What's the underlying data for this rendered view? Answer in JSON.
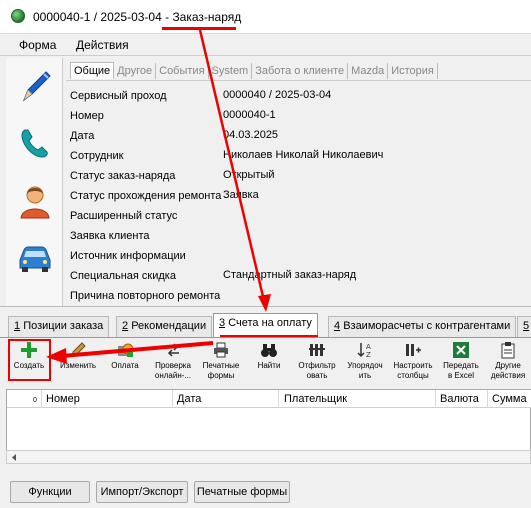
{
  "window": {
    "title_prefix": "0000040-1 / 2025-03-04 - ",
    "title_doc": "Заказ-наряд"
  },
  "menu": [
    "Форма",
    "Действия"
  ],
  "header_tabs": [
    "Общие",
    "Другое",
    "События",
    "System",
    "Забота о клиенте",
    "Mazda",
    "История"
  ],
  "fields": [
    {
      "label": "Сервисный проход",
      "value": "0000040 / 2025-03-04"
    },
    {
      "label": "Номер",
      "value": "0000040-1"
    },
    {
      "label": "Дата",
      "value": "04.03.2025"
    },
    {
      "label": "Сотрудник",
      "value": "Николаев Николай Николаевич"
    },
    {
      "label": "Статус заказ-наряда",
      "value": "Открытый"
    },
    {
      "label": "Статус прохождения ремонта",
      "value": "Заявка"
    },
    {
      "label": "Расширенный статус",
      "value": ""
    },
    {
      "label": "Заявка клиента",
      "value": ""
    },
    {
      "label": "Источник информации",
      "value": ""
    },
    {
      "label": "Специальная скидка",
      "value": "Стандартный заказ-наряд"
    },
    {
      "label": "Причина повторного ремонта",
      "value": ""
    }
  ],
  "bottom_tabs": [
    {
      "num": "1",
      "label": "Позиции заказа"
    },
    {
      "num": "2",
      "label": "Рекомендации"
    },
    {
      "num": "3",
      "label": "Счета на оплату"
    },
    {
      "num": "4",
      "label": "Взаиморасчеты с контрагентами"
    },
    {
      "num": "5",
      "label": ""
    }
  ],
  "toolbar": [
    {
      "label": "Создать",
      "icon": "plus-icon"
    },
    {
      "label": "Изменить",
      "icon": "pencil-icon"
    },
    {
      "label": "Оплата",
      "icon": "payment-icon"
    },
    {
      "label": "Проверка\nонлайн-...",
      "icon": "arrows-icon"
    },
    {
      "label": "Печатные\nформы",
      "icon": "printer-icon"
    },
    {
      "label": "Найти",
      "icon": "binoculars-icon"
    },
    {
      "label": "Отфильтр\nовать",
      "icon": "filter-icon"
    },
    {
      "label": "Упорядоч\nить",
      "icon": "sort-icon"
    },
    {
      "label": "Настроить\nстолбцы",
      "icon": "columns-icon"
    },
    {
      "label": "Передать\nв Excel",
      "icon": "excel-icon"
    },
    {
      "label": "Другие\nдействия",
      "icon": "clipboard-icon"
    }
  ],
  "grid": {
    "row_count": "0",
    "columns": [
      "Номер",
      "Дата",
      "Плательщик",
      "Валюта",
      "Сумма"
    ]
  },
  "buttons": [
    "Функции",
    "Импорт/Экспорт",
    "Печатные формы"
  ],
  "colors": {
    "annotation": "#e00000",
    "create_icon": "#1e9e2e"
  }
}
